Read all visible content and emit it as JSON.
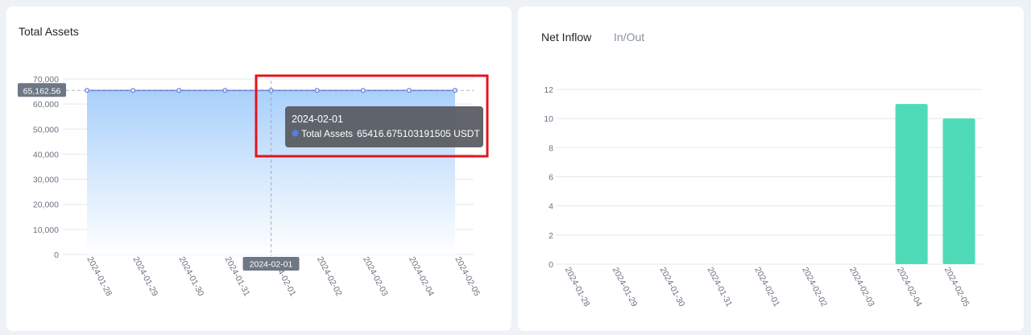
{
  "left_panel": {
    "title": "Total Assets",
    "crosshair_y_label": "65,162.56",
    "crosshair_x_label": "2024-02-01",
    "tooltip": {
      "date": "2024-02-01",
      "series_name": "Total Assets",
      "value_text": "65416.675103191505 USDT"
    }
  },
  "right_panel": {
    "tabs": [
      {
        "label": "Net Inflow",
        "active": true
      },
      {
        "label": "In/Out",
        "active": false
      }
    ]
  },
  "colors": {
    "line": "#5a7ee8",
    "area_top": "#a9d0fb",
    "area_bottom": "#ffffff",
    "bar": "#4fdbb8",
    "highlight": "#e0161c",
    "tooltip_bg": "#5a5d63"
  },
  "chart_data": [
    {
      "type": "area",
      "title": "Total Assets",
      "categories": [
        "2024-01-28",
        "2024-01-29",
        "2024-01-30",
        "2024-01-31",
        "2024-02-01",
        "2024-02-02",
        "2024-02-03",
        "2024-02-04",
        "2024-02-05"
      ],
      "series": [
        {
          "name": "Total Assets",
          "values": [
            65416.68,
            65416.68,
            65416.68,
            65416.68,
            65416.68,
            65416.68,
            65416.68,
            65416.68,
            65416.68
          ]
        }
      ],
      "yticks": [
        "0",
        "10,000",
        "20,000",
        "30,000",
        "40,000",
        "50,000",
        "60,000",
        "70,000"
      ],
      "ylim": [
        0,
        70000
      ],
      "grid": true,
      "tooltip_category": "2024-02-01"
    },
    {
      "type": "bar",
      "title": "Net Inflow",
      "categories": [
        "2024-01-28",
        "2024-01-29",
        "2024-01-30",
        "2024-01-31",
        "2024-02-01",
        "2024-02-02",
        "2024-02-03",
        "2024-02-04",
        "2024-02-05"
      ],
      "values": [
        0,
        0,
        0,
        0,
        0,
        0,
        0,
        11,
        10
      ],
      "yticks": [
        "0",
        "2",
        "4",
        "6",
        "8",
        "10",
        "12"
      ],
      "ylim": [
        0,
        12
      ],
      "grid": true
    }
  ]
}
